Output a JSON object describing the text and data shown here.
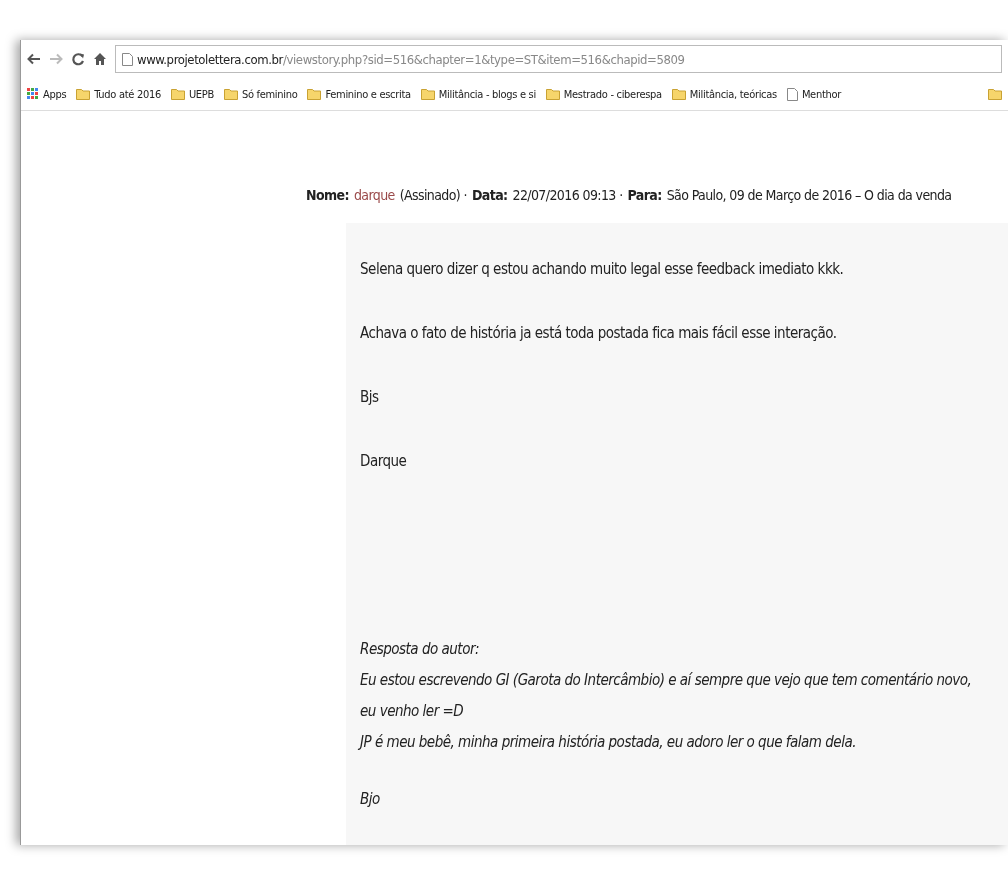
{
  "browser": {
    "url_domain": "www.projetolettera.com.br",
    "url_path": "/viewstory.php?sid=516&chapter=1&type=ST&item=516&chapid=5809"
  },
  "bookmarks": [
    {
      "kind": "apps",
      "label": "Apps"
    },
    {
      "kind": "folder",
      "label": "Tudo até 2016"
    },
    {
      "kind": "folder",
      "label": "UEPB"
    },
    {
      "kind": "folder",
      "label": "Só feminino"
    },
    {
      "kind": "folder",
      "label": "Feminino e escrita"
    },
    {
      "kind": "folder",
      "label": "Militância - blogs e si"
    },
    {
      "kind": "folder",
      "label": "Mestrado - ciberespa"
    },
    {
      "kind": "folder",
      "label": "Militância, teóricas"
    },
    {
      "kind": "page",
      "label": "Menthor"
    }
  ],
  "overflow_folder": true,
  "review": {
    "name_label": "Nome:",
    "name": "darque",
    "signed": "(Assinado) ·",
    "date_label": "Data:",
    "date": "22/07/2016 09:13 ·",
    "to_label": "Para:",
    "to": "São Paulo, 09 de Março de 2016 – O dia da venda"
  },
  "comment": [
    "Selena quero dizer q estou achando muito legal esse feedback imediato kkk.",
    "Achava o fato de história ja está toda postada fica mais fácil esse interação.",
    "Bjs",
    "Darque"
  ],
  "reply": {
    "title": "Resposta do autor:",
    "lines": [
      "Eu estou escrevendo GI (Garota do Intercâmbio) e aí sempre que vejo que tem comentário novo, eu venho ler =D",
      "JP é meu bebê, minha primeira história postada, eu adoro ler o que falam dela."
    ],
    "sign": "Bjo"
  }
}
